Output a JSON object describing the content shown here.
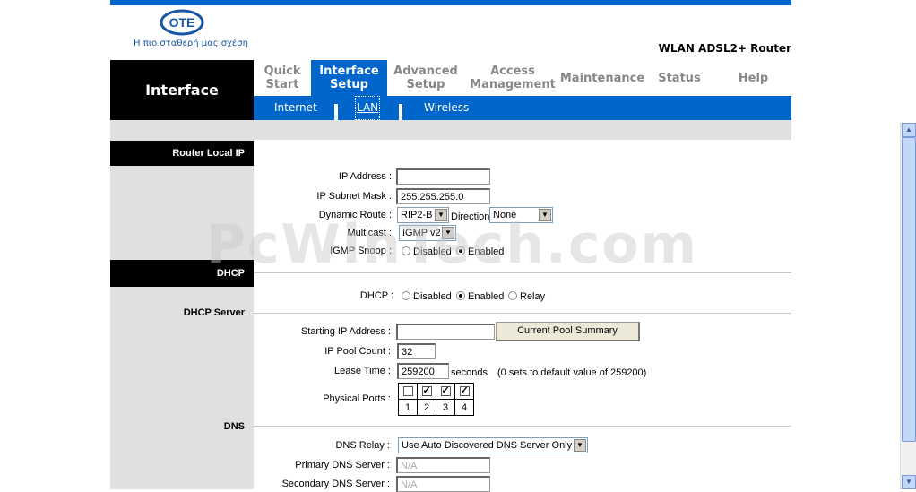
{
  "header": {
    "logo_text": "OTE",
    "slogan": "Η πιο σταθερή μας σχέση",
    "product": "WLAN ADSL2+ Router"
  },
  "section_title": "Interface",
  "tabs": [
    {
      "line1": "Quick",
      "line2": "Start"
    },
    {
      "line1": "Interface",
      "line2": "Setup"
    },
    {
      "line1": "Advanced",
      "line2": "Setup"
    },
    {
      "line1": "Access",
      "line2": "Management"
    },
    {
      "line1": "Maintenance",
      "line2": ""
    },
    {
      "line1": "Status",
      "line2": ""
    },
    {
      "line1": "Help",
      "line2": ""
    }
  ],
  "subtabs": [
    "Internet",
    "LAN",
    "Wireless"
  ],
  "router_local_ip": {
    "heading": "Router Local IP",
    "ip_label": "IP Address :",
    "ip_value": "",
    "mask_label": "IP Subnet Mask :",
    "mask_value": "255.255.255.0",
    "route_label": "Dynamic Route :",
    "route_value": "RIP2-B",
    "direction_label": "Direction",
    "direction_value": "None",
    "multicast_label": "Multicast :",
    "multicast_value": "IGMP v2",
    "igmp_label": "IGMP Snoop :",
    "disabled": "Disabled",
    "enabled": "Enabled"
  },
  "dhcp": {
    "heading": "DHCP",
    "dhcp_label": "DHCP :",
    "disabled": "Disabled",
    "enabled": "Enabled",
    "relay": "Relay",
    "server_heading": "DHCP Server",
    "start_label": "Starting IP Address :",
    "start_value": "",
    "pool_button": "Current Pool Summary",
    "pool_label": "IP Pool Count :",
    "pool_value": "32",
    "lease_label": "Lease Time :",
    "lease_value": "259200",
    "lease_unit": "seconds",
    "lease_note": "(0 sets to default value of 259200)",
    "ports_label": "Physical Ports :",
    "ports": [
      "1",
      "2",
      "3",
      "4"
    ],
    "ports_checked": [
      false,
      true,
      true,
      true
    ]
  },
  "dns": {
    "heading": "DNS",
    "relay_label": "DNS Relay :",
    "relay_value": "Use Auto Discovered DNS Server Only",
    "primary_label": "Primary DNS Server :",
    "primary_value": "N/A",
    "secondary_label": "Secondary DNS Server :",
    "secondary_value": "N/A"
  },
  "watermark": "PcWinTech.com"
}
